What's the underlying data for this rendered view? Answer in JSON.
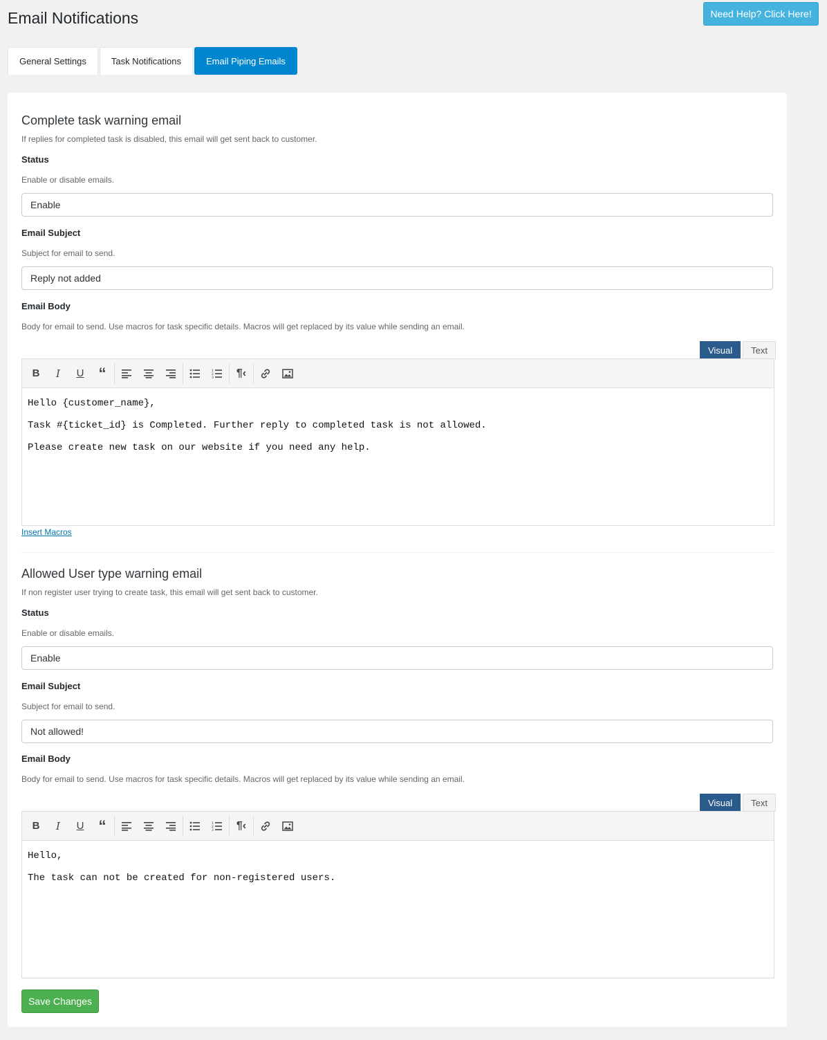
{
  "header": {
    "title": "Email Notifications",
    "help_label": "Need Help? Click Here!"
  },
  "tabs": [
    {
      "label": "General Settings",
      "active": false
    },
    {
      "label": "Task Notifications",
      "active": false
    },
    {
      "label": "Email Piping Emails",
      "active": true
    }
  ],
  "sections": [
    {
      "title": "Complete task warning email",
      "description": "If replies for completed task is disabled, this email will get sent back to customer.",
      "status_label": "Status",
      "status_hint": "Enable or disable emails.",
      "status_value": "Enable",
      "subject_label": "Email Subject",
      "subject_hint": "Subject for email to send.",
      "subject_value": "Reply not added",
      "body_label": "Email Body",
      "body_hint": "Body for email to send. Use macros for task specific details. Macros will get replaced by its value while sending an email.",
      "editor_tabs": [
        "Visual",
        "Text"
      ],
      "body_lines": [
        "Hello {customer_name},",
        "Task #{ticket_id} is Completed. Further reply to completed task is not allowed.",
        "Please create new task on our website if you need any help."
      ],
      "macros_link": "Insert Macros"
    },
    {
      "title": "Allowed User type warning email",
      "description": "If non register user trying to create task, this email will get sent back to customer.",
      "status_label": "Status",
      "status_hint": "Enable or disable emails.",
      "status_value": "Enable",
      "subject_label": "Email Subject",
      "subject_hint": "Subject for email to send.",
      "subject_value": "Not allowed!",
      "body_label": "Email Body",
      "body_hint": "Body for email to send. Use macros for task specific details. Macros will get replaced by its value while sending an email.",
      "editor_tabs": [
        "Visual",
        "Text"
      ],
      "body_lines": [
        "Hello,",
        "The task can not be created for non-registered users."
      ]
    }
  ],
  "toolbar_icons": [
    "bold-icon",
    "italic-icon",
    "underline-icon",
    "blockquote-icon",
    "align-left-icon",
    "align-center-icon",
    "align-right-icon",
    "bullet-list-icon",
    "numbered-list-icon",
    "paragraph-icon",
    "link-icon",
    "image-icon"
  ],
  "save_label": "Save Changes",
  "colors": {
    "accent": "#0085d0",
    "help": "#46b3de",
    "save": "#4caf50",
    "visual_tab": "#2b5b8c"
  }
}
